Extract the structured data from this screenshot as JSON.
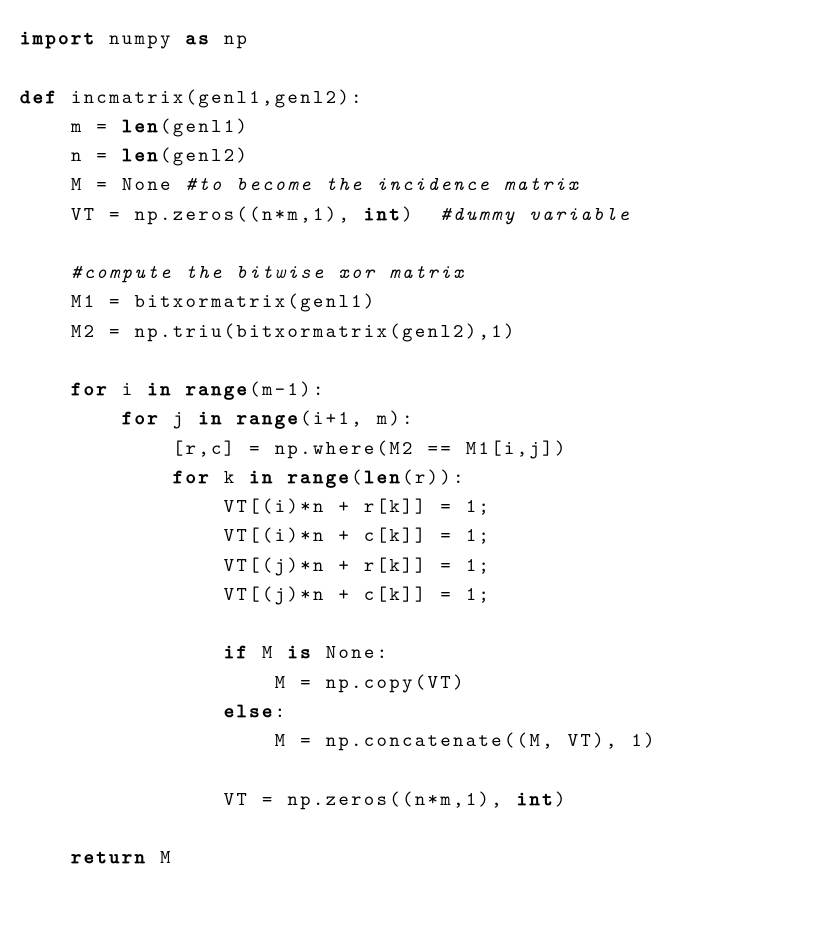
{
  "code": {
    "l1_kw1": "import",
    "l1_t1": " numpy ",
    "l1_kw2": "as",
    "l1_t2": " np",
    "l3_kw1": "def",
    "l3_t1": " incmatrix(genl1,genl2):",
    "l4_t1": "    m = ",
    "l4_bi1": "len",
    "l4_t2": "(genl1)",
    "l5_t1": "    n = ",
    "l5_bi1": "len",
    "l5_t2": "(genl2)",
    "l6_t1": "    M = None ",
    "l6_cm1": "#to become the incidence matrix",
    "l7_t1": "    VT = np.zeros((n*m,1), ",
    "l7_bi1": "int",
    "l7_t2": ")  ",
    "l7_cm1": "#dummy variable",
    "l9_t1": "    ",
    "l9_cm1": "#compute the bitwise xor matrix",
    "l10_t1": "    M1 = bitxormatrix(genl1)",
    "l11_t1": "    M2 = np.triu(bitxormatrix(genl2),1)",
    "l13_t1": "    ",
    "l13_kw1": "for",
    "l13_t2": " i ",
    "l13_kw2": "in",
    "l13_t3": " ",
    "l13_bi1": "range",
    "l13_t4": "(m-1):",
    "l14_t1": "        ",
    "l14_kw1": "for",
    "l14_t2": " j ",
    "l14_kw2": "in",
    "l14_t3": " ",
    "l14_bi1": "range",
    "l14_t4": "(i+1, m):",
    "l15_t1": "            [r,c] = np.where(M2 == M1[i,j])",
    "l16_t1": "            ",
    "l16_kw1": "for",
    "l16_t2": " k ",
    "l16_kw2": "in",
    "l16_t3": " ",
    "l16_bi1": "range",
    "l16_t4": "(",
    "l16_bi2": "len",
    "l16_t5": "(r)):",
    "l17_t1": "                VT[(i)*n + r[k]] = 1;",
    "l18_t1": "                VT[(i)*n + c[k]] = 1;",
    "l19_t1": "                VT[(j)*n + r[k]] = 1;",
    "l20_t1": "                VT[(j)*n + c[k]] = 1;",
    "l22_t1": "                ",
    "l22_kw1": "if",
    "l22_t2": " M ",
    "l22_kw2": "is",
    "l22_t3": " None:",
    "l23_t1": "                    M = np.copy(VT)",
    "l24_t1": "                ",
    "l24_kw1": "else",
    "l24_t2": ":",
    "l25_t1": "                    M = np.concatenate((M, VT), 1)",
    "l27_t1": "                VT = np.zeros((n*m,1), ",
    "l27_bi1": "int",
    "l27_t2": ")",
    "l29_t1": "    ",
    "l29_kw1": "return",
    "l29_t2": " M"
  }
}
